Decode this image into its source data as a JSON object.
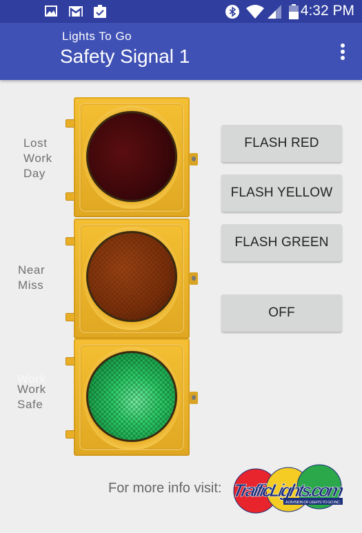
{
  "status_bar": {
    "left_icons": [
      "gallery-icon",
      "gmail-icon",
      "clipboard-check-icon"
    ],
    "right_icons": [
      "bluetooth-icon",
      "wifi-icon",
      "cell-signal-icon",
      "battery-icon"
    ],
    "time": "4:32 PM"
  },
  "app_bar": {
    "subtitle": "Lights To Go",
    "title": "Safety Signal 1",
    "menu_icon": "more-vert-icon"
  },
  "signal": {
    "lamps": [
      {
        "name": "red",
        "label_lines": [
          "Lost",
          "Work",
          "Day"
        ],
        "state": "off"
      },
      {
        "name": "yellow",
        "label_lines": [
          "Near",
          "Miss"
        ],
        "state": "off"
      },
      {
        "name": "green",
        "label_lines": [
          "Work",
          "Safe"
        ],
        "state": "on",
        "ghost_label": "Work"
      }
    ]
  },
  "buttons": {
    "flash_red": "FLASH RED",
    "flash_yellow": "FLASH YELLOW",
    "flash_green": "FLASH GREEN",
    "off": "OFF"
  },
  "footer": {
    "text": "For more info visit:",
    "logo_text": "TrafficLights.com",
    "logo_tagline": "A DIVISION OF LIGHTS TO GO INC.",
    "logo_colors": {
      "red": "#e8242c",
      "yellow": "#f4cc24",
      "green": "#2aa84a",
      "navy": "#1c2f7a"
    }
  }
}
